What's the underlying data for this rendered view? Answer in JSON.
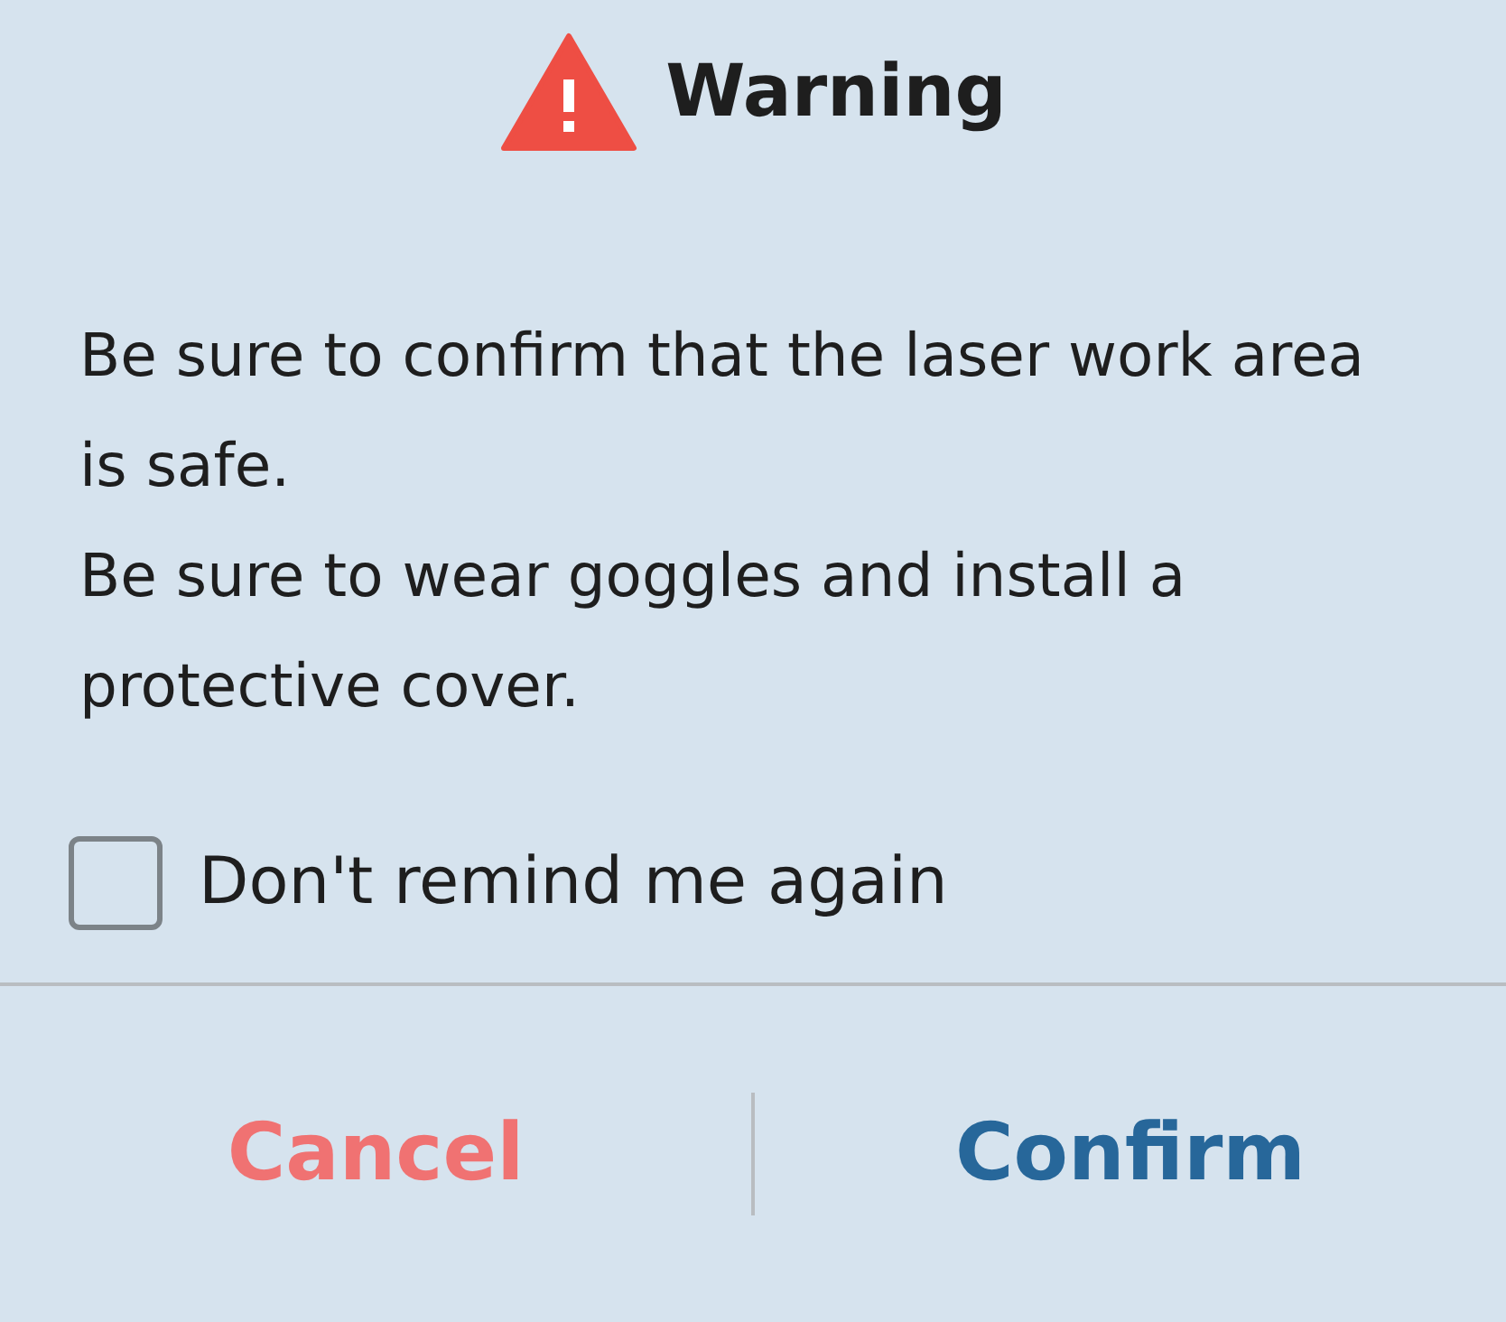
{
  "dialog": {
    "title": "Warning",
    "messages": [
      "Be sure to confirm that the laser work area is safe.",
      "Be sure to wear goggles and install a protective cover."
    ],
    "reminder": {
      "label": "Don't remind me again",
      "checked": false
    },
    "buttons": [
      {
        "label": "Cancel",
        "kind": "cancel"
      },
      {
        "label": "Confirm",
        "kind": "confirm"
      }
    ]
  }
}
